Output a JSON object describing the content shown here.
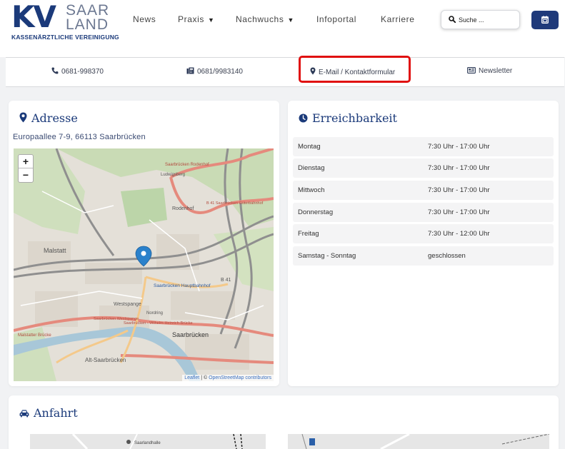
{
  "logo": {
    "kv": "KV",
    "saar": "SAAR",
    "land": "LAND",
    "subtitle": "KASSENÄRZTLICHE VEREINIGUNG"
  },
  "nav": {
    "items": [
      {
        "label": "News",
        "has_dropdown": false
      },
      {
        "label": "Praxis",
        "has_dropdown": true
      },
      {
        "label": "Nachwuchs",
        "has_dropdown": true
      },
      {
        "label": "Infoportal",
        "has_dropdown": false
      },
      {
        "label": "Karriere",
        "has_dropdown": false
      }
    ]
  },
  "search": {
    "placeholder": "Suche ...",
    "icon": "search-icon"
  },
  "calendar_button": {
    "icon": "calendar-icon"
  },
  "contact": {
    "phone": "0681-998370",
    "fax": "0681/9983140",
    "email": "E-Mail / Kontaktformular",
    "newsletter": "Newsletter"
  },
  "address_card": {
    "title": "Adresse",
    "address": "Europaallee 7-9, 66113 Saarbrücken"
  },
  "map": {
    "zoom_in": "+",
    "zoom_out": "−",
    "attribution_leaflet": "Leaflet",
    "attribution_sep": " | © ",
    "attribution_osm": "OpenStreetMap contributors",
    "labels": {
      "malstatt": "Malstatt",
      "westspange": "Westspange",
      "saarbruecken": "Saarbrücken",
      "hbf": "Saarbrücken Hauptbahnhof",
      "alt_saarbruecken": "Alt-Saarbrücken",
      "rodenhof": "Rodenhof",
      "b41": "B 41",
      "rodenhof_street": "Saarbrücken Rodenhof",
      "malstatter_bruecke": "Malstatter Brücke",
      "wilhelm": "Saarbrücken - Wilhelm-Heinrich-Brücke",
      "westspange_street": "Saarbrücken Westspange",
      "nordring": "Nordring",
      "ludwigsberg": "Ludwigsberg",
      "guterbahnhof": "B 41 Saarbrücken Güterbahnhof"
    },
    "colors": {
      "road_red": "#e58a7d",
      "rail": "#8f8f8f",
      "river": "#a9c8d9",
      "green": "#cbdcb9",
      "marker": "#2a81cb"
    }
  },
  "hours_card": {
    "title": "Erreichbarkeit",
    "rows": [
      {
        "day": "Montag",
        "time": "7:30 Uhr - 17:00 Uhr"
      },
      {
        "day": "Dienstag",
        "time": "7:30 Uhr - 17:00 Uhr"
      },
      {
        "day": "Mittwoch",
        "time": "7:30 Uhr - 17:00 Uhr"
      },
      {
        "day": "Donnerstag",
        "time": "7:30 Uhr - 17:00 Uhr"
      },
      {
        "day": "Freitag",
        "time": "7:30 Uhr - 12:00 Uhr"
      },
      {
        "day": "Samstag - Sonntag",
        "time": "geschlossen"
      }
    ]
  },
  "directions_card": {
    "title": "Anfahrt",
    "map_label": "Saarlandhalle"
  },
  "colors": {
    "brand_blue": "#1b3a7a",
    "brand_grey": "#6c7891",
    "highlight_red": "#e01010"
  }
}
